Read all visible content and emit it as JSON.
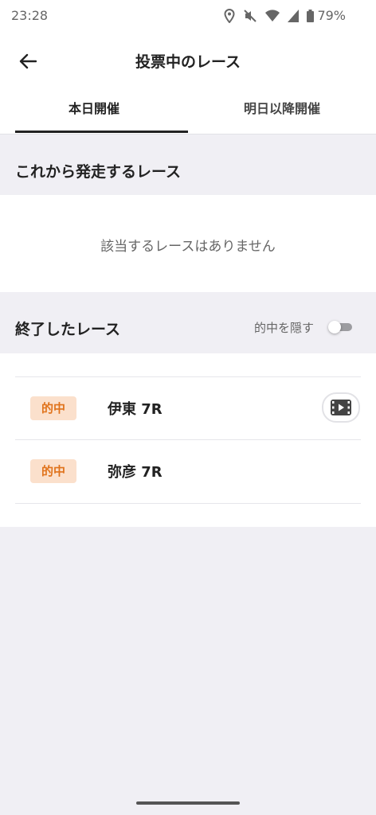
{
  "status": {
    "time": "23:28",
    "battery": "79%",
    "icons": [
      "location-icon",
      "mute-icon",
      "wifi-icon",
      "signal-icon",
      "battery-icon"
    ]
  },
  "header": {
    "title": "投票中のレース",
    "back_icon": "back-arrow-icon"
  },
  "tabs": [
    {
      "label": "本日開催",
      "selected": true
    },
    {
      "label": "明日以降開催",
      "selected": false
    }
  ],
  "upcoming": {
    "title": "これから発走するレース",
    "empty_text": "該当するレースはありません"
  },
  "finished": {
    "title": "終了したレース",
    "hide_hits_label": "的中を隠す",
    "hide_hits_on": false,
    "races": [
      {
        "badge": "的中",
        "name": "伊東 7R",
        "has_video": true
      },
      {
        "badge": "的中",
        "name": "弥彦 7R",
        "has_video": false
      }
    ]
  },
  "colors": {
    "accent": "#e0731c",
    "badge_bg": "#fbe0cc",
    "background": "#f0eff4"
  }
}
